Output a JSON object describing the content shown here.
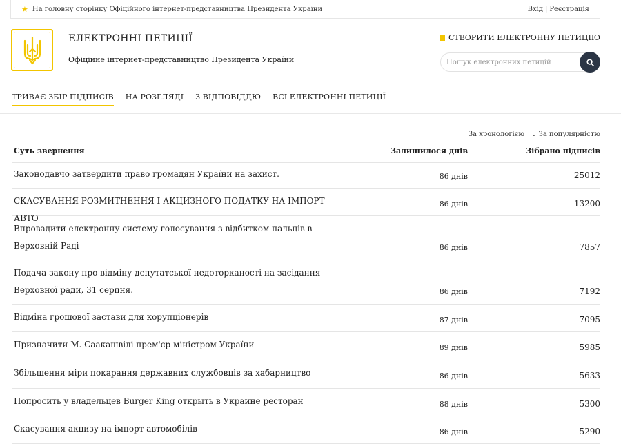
{
  "topbar": {
    "home_link": "На головну сторінку Офіційного інтернет-представництва Президента України",
    "login": "Вхід",
    "separator": "|",
    "register": "Реєстрація"
  },
  "header": {
    "title": "ЕЛЕКТРОННІ ПЕТИЦІЇ",
    "subtitle": "Офіційне інтернет-представництво Президента України",
    "create_label": "СТВОРИТИ ЕЛЕКТРОННУ ПЕТИЦІЮ",
    "search_placeholder": "Пошук електронних петицій",
    "search_value": ""
  },
  "tabs": [
    {
      "label": "ТРИВАЄ ЗБІР ПІДПИСІВ",
      "active": true
    },
    {
      "label": "НА РОЗГЛЯДІ",
      "active": false
    },
    {
      "label": "З ВІДПОВІДДЮ",
      "active": false
    },
    {
      "label": "ВСІ ЕЛЕКТРОННІ ПЕТИЦІЇ",
      "active": false
    }
  ],
  "sort": {
    "chronology": "За хронологією",
    "popularity": "За популярністю"
  },
  "table": {
    "headers": {
      "title": "Суть звернення",
      "days": "Залишилося днів",
      "signatures": "Зібрано підписів"
    },
    "rows": [
      {
        "title": "Законодавчо затвердити право громадян України на захист.",
        "days": "86 днів",
        "signatures": "25012"
      },
      {
        "title": "СКАСУВАННЯ РОЗМИТНЕННЯ І АКЦИЗНОГО ПОДАТКУ НА ІМПОРТ АВТО",
        "days": "86 днів",
        "signatures": "13200"
      },
      {
        "title": "Впровадити електронну систему голосування з відбитком пальців в Верховній Раді",
        "days": "86 днів",
        "signatures": "7857"
      },
      {
        "title": "Подача закону про відміну депутатської недоторканості на засідання Верховної ради, 31 серпня.",
        "days": "86 днів",
        "signatures": "7192"
      },
      {
        "title": "Відміна грошової застави для корупціонерів",
        "days": "87 днів",
        "signatures": "7095"
      },
      {
        "title": "Призначити М. Саакашвілі прем'єр-міністром України",
        "days": "89 днів",
        "signatures": "5985"
      },
      {
        "title": "Збільшення міри покарання державних службовців за хабарництво",
        "days": "86 днів",
        "signatures": "5633"
      },
      {
        "title": "Попросить у владельцев Burger King открыть в Украине ресторан",
        "days": "88 днів",
        "signatures": "5300"
      },
      {
        "title": "Скасування акцизу на імпорт автомобілів",
        "days": "86 днів",
        "signatures": "5290"
      }
    ]
  },
  "colors": {
    "accent": "#f2c500",
    "search_button": "#2b3545",
    "divider": "#e5e5e5"
  },
  "icons": {
    "home": "star-icon",
    "create": "document-icon",
    "search": "search-icon",
    "sort": "chevron-down-icon",
    "logo": "trident-emblem"
  }
}
